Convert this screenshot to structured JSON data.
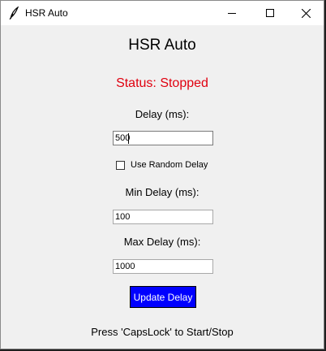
{
  "window": {
    "title": "HSR Auto",
    "controls": {
      "minimize": "minimize-icon",
      "maximize": "maximize-icon",
      "close": "close-icon"
    }
  },
  "app": {
    "heading": "HSR Auto",
    "status": "Status: Stopped",
    "status_color": "#e0000f",
    "delay_label": "Delay (ms):",
    "delay_value": "500",
    "random_delay_label": "Use Random Delay",
    "random_delay_checked": false,
    "min_delay_label": "Min Delay (ms):",
    "min_delay_value": "100",
    "max_delay_label": "Max Delay (ms):",
    "max_delay_value": "1000",
    "update_button": "Update Delay",
    "update_button_color": "#0000ff",
    "footer_hint": "Press 'CapsLock' to Start/Stop"
  }
}
